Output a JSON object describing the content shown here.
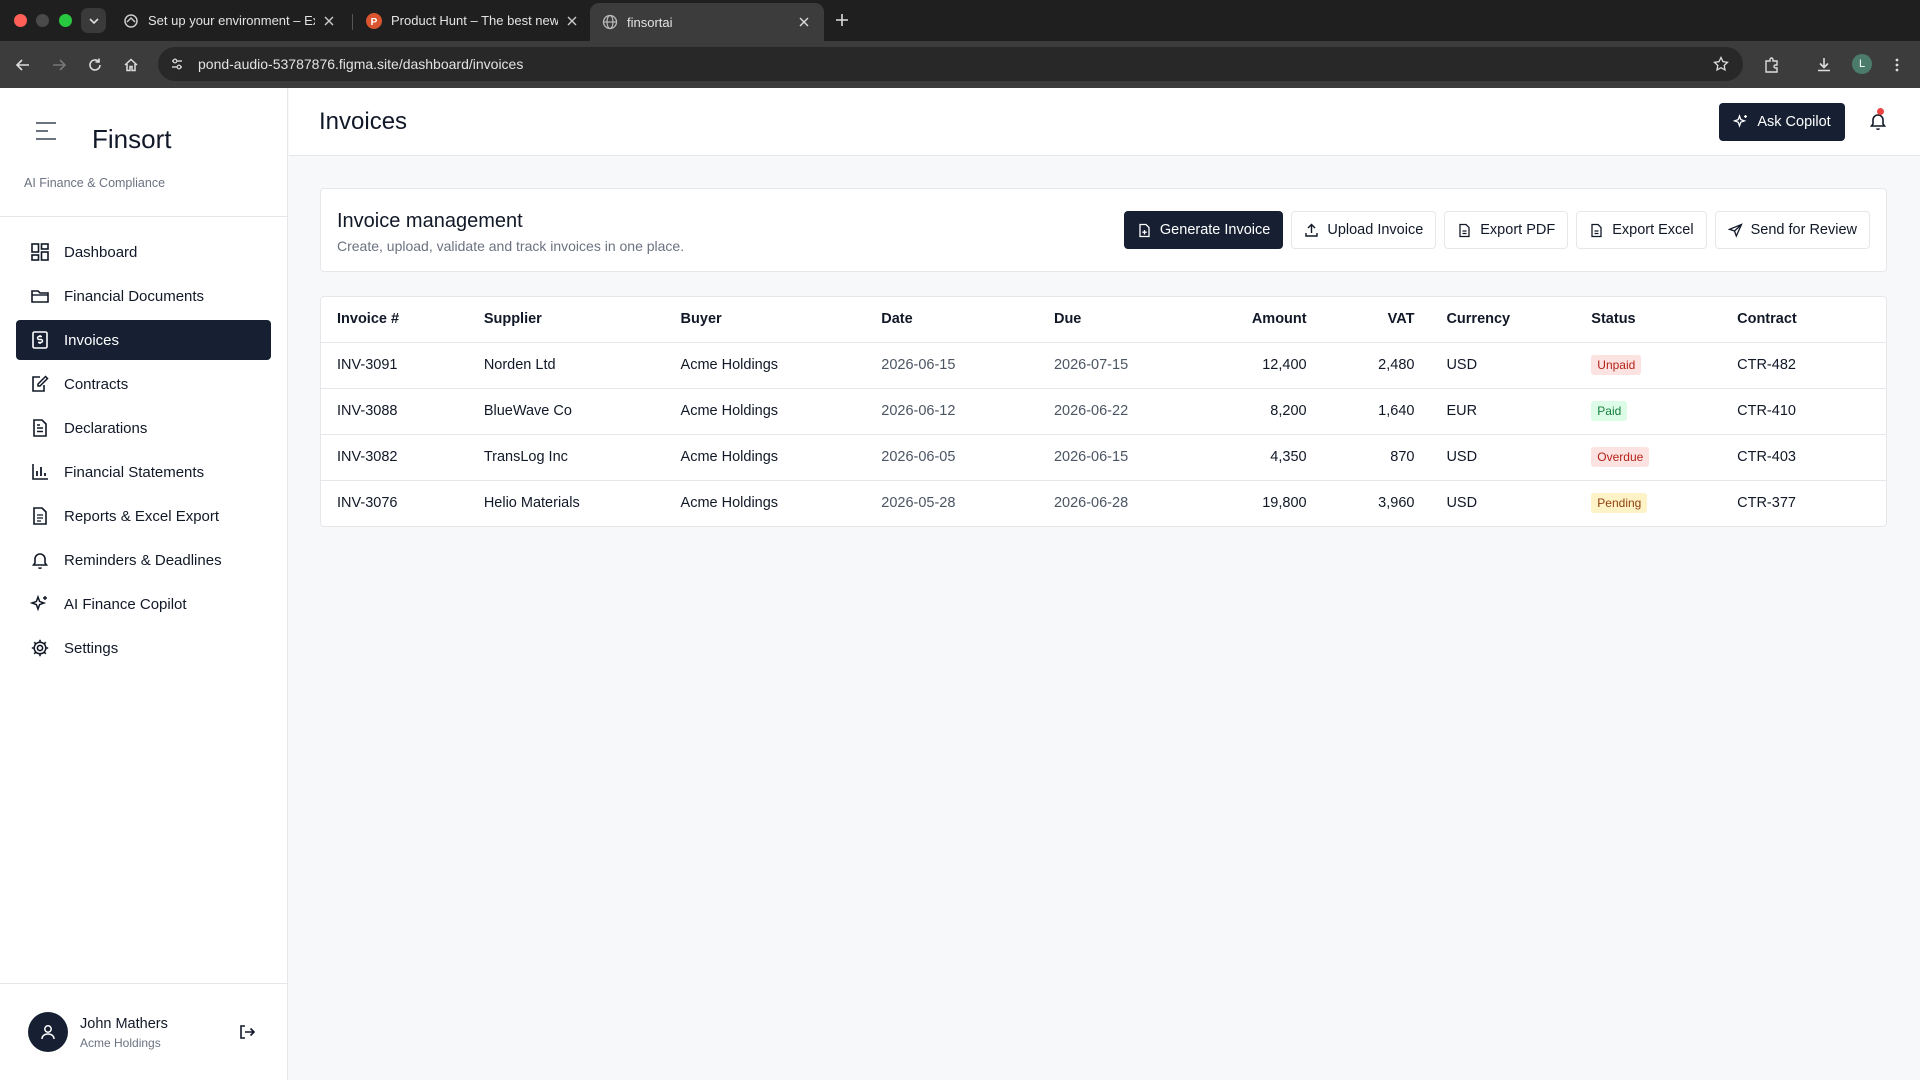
{
  "browser": {
    "tabs": [
      {
        "title": "Set up your environment – Ex",
        "icon": "workspace-icon"
      },
      {
        "title": "Product Hunt – The best new",
        "icon": "producthunt-icon"
      },
      {
        "title": "finsortai",
        "icon": "globe-icon"
      }
    ],
    "url": "pond-audio-53787876.figma.site/dashboard/invoices",
    "profile_initial": "L"
  },
  "sidebar": {
    "brand": "Finsort",
    "tagline": "AI Finance & Compliance",
    "items": [
      {
        "label": "Dashboard",
        "icon": "dashboard-grid-icon"
      },
      {
        "label": "Financial Documents",
        "icon": "folder-icon"
      },
      {
        "label": "Invoices",
        "icon": "receipt-icon"
      },
      {
        "label": "Contracts",
        "icon": "contract-pen-icon"
      },
      {
        "label": "Declarations",
        "icon": "document-icon"
      },
      {
        "label": "Financial Statements",
        "icon": "bar-chart-icon"
      },
      {
        "label": "Reports & Excel Export",
        "icon": "report-icon"
      },
      {
        "label": "Reminders & Deadlines",
        "icon": "bell-icon"
      },
      {
        "label": "AI Finance Copilot",
        "icon": "sparkles-icon"
      },
      {
        "label": "Settings",
        "icon": "gear-icon"
      }
    ],
    "active_index": 2,
    "user": {
      "name": "John Mathers",
      "org": "Acme Holdings"
    }
  },
  "header": {
    "title": "Invoices",
    "copilot_label": "Ask Copilot",
    "notification_dot_color": "#ef4444"
  },
  "card": {
    "title": "Invoice management",
    "subtitle": "Create, upload, validate and track invoices in one place.",
    "actions": [
      {
        "label": "Generate Invoice",
        "icon": "file-plus-icon"
      },
      {
        "label": "Upload Invoice",
        "icon": "upload-icon"
      },
      {
        "label": "Export PDF",
        "icon": "file-icon"
      },
      {
        "label": "Export Excel",
        "icon": "file-icon"
      },
      {
        "label": "Send for Review",
        "icon": "send-icon"
      }
    ]
  },
  "table": {
    "columns": [
      "Invoice #",
      "Supplier",
      "Buyer",
      "Date",
      "Due",
      "Amount",
      "VAT",
      "Currency",
      "Status",
      "Contract"
    ],
    "rows": [
      {
        "invoice": "INV-3091",
        "supplier": "Norden Ltd",
        "buyer": "Acme Holdings",
        "date": "2026-06-15",
        "due": "2026-07-15",
        "amount": "12,400",
        "vat": "2,480",
        "currency": "USD",
        "status": "Unpaid",
        "contract": "CTR-482"
      },
      {
        "invoice": "INV-3088",
        "supplier": "BlueWave Co",
        "buyer": "Acme Holdings",
        "date": "2026-06-12",
        "due": "2026-06-22",
        "amount": "8,200",
        "vat": "1,640",
        "currency": "EUR",
        "status": "Paid",
        "contract": "CTR-410"
      },
      {
        "invoice": "INV-3082",
        "supplier": "TransLog Inc",
        "buyer": "Acme Holdings",
        "date": "2026-06-05",
        "due": "2026-06-15",
        "amount": "4,350",
        "vat": "870",
        "currency": "USD",
        "status": "Overdue",
        "contract": "CTR-403"
      },
      {
        "invoice": "INV-3076",
        "supplier": "Helio Materials",
        "buyer": "Acme Holdings",
        "date": "2026-05-28",
        "due": "2026-06-28",
        "amount": "19,800",
        "vat": "3,960",
        "currency": "USD",
        "status": "Pending",
        "contract": "CTR-377"
      }
    ]
  },
  "colors": {
    "accent": "#172033",
    "status_unpaid": "#b42318",
    "status_paid": "#15803d",
    "status_pending": "#92400e"
  }
}
